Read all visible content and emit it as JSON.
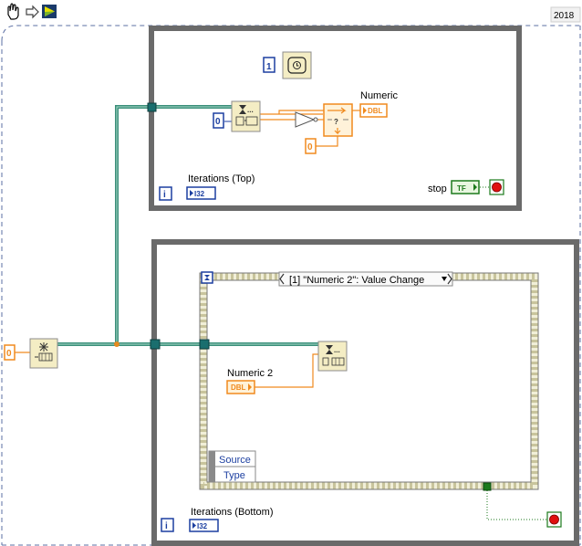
{
  "toolbar": {
    "version": "2018"
  },
  "top_loop": {
    "wait_input": "1",
    "dequeue_timeout": "0",
    "select_false": "0",
    "indicator_label": "Numeric",
    "indicator_type": "DBL",
    "iterations_label": "Iterations (Top)",
    "iterations_type": "I32",
    "stop_label": "stop",
    "stop_type": "TF"
  },
  "main": {
    "queue_size": "0"
  },
  "bottom_loop": {
    "event_case": "[1] \"Numeric 2\": Value Change",
    "control_label": "Numeric 2",
    "control_type": "DBL",
    "event_data": [
      "Source",
      "Type"
    ],
    "iterations_label": "Iterations (Bottom)",
    "iterations_type": "I32"
  }
}
